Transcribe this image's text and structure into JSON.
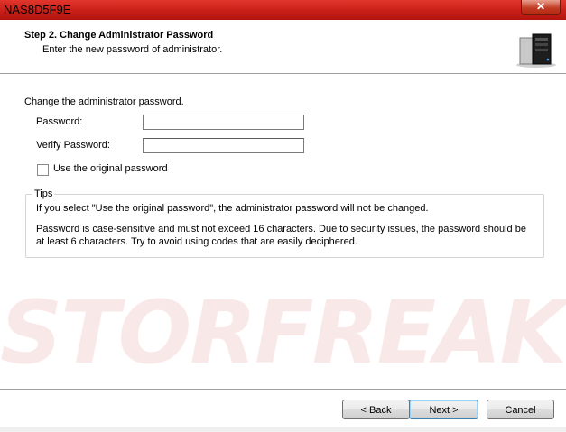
{
  "window": {
    "title": "NAS8D5F9E",
    "close_glyph": "✕"
  },
  "header": {
    "step_title": "Step 2. Change Administrator Password",
    "step_subtitle": "Enter the new password of administrator.",
    "icon": "nas-device-icon"
  },
  "form": {
    "intro": "Change the administrator password.",
    "password_label": "Password:",
    "password_value": "",
    "verify_label": "Verify Password:",
    "verify_value": "",
    "use_original_label": "Use the original password",
    "use_original_checked": false
  },
  "tips": {
    "legend": "Tips",
    "line1": "If you select \"Use the original password\", the administrator password will not be changed.",
    "line2": "Password is case-sensitive and must not exceed 16 characters. Due to security issues, the password should be at least 6 characters. Try to avoid using codes that are easily deciphered."
  },
  "watermark": {
    "text": "STORFREAKS"
  },
  "buttons": {
    "back": "< Back",
    "next": "Next >",
    "cancel": "Cancel"
  },
  "colors": {
    "titlebar": "#c81f18",
    "accent_default_button": "#3c7fb1"
  }
}
